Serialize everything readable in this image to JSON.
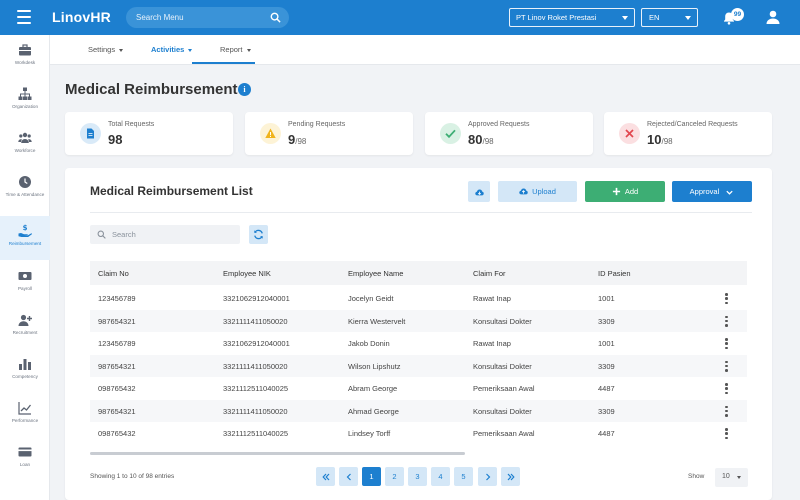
{
  "app": {
    "brand": "LinovHR",
    "search_placeholder": "Search Menu",
    "company": "PT Linov Roket Prestasi",
    "language": "EN",
    "notification_count": "99"
  },
  "sidebar": {
    "items": [
      {
        "label": "Workdesk",
        "icon": "briefcase-icon"
      },
      {
        "label": "Organization",
        "icon": "org-chart-icon"
      },
      {
        "label": "Workforce",
        "icon": "people-icon"
      },
      {
        "label": "Time & Attendance",
        "icon": "clock-icon"
      },
      {
        "label": "Reimbursement",
        "icon": "hand-dollar-icon"
      },
      {
        "label": "Payroll",
        "icon": "money-icon"
      },
      {
        "label": "Recruitment",
        "icon": "user-plus-icon"
      },
      {
        "label": "Competency",
        "icon": "bar-chart-icon"
      },
      {
        "label": "Performance",
        "icon": "trend-chart-icon"
      },
      {
        "label": "Loan",
        "icon": "card-icon"
      }
    ]
  },
  "subnav": {
    "tabs": [
      {
        "label": "Settings"
      },
      {
        "label": "Activities"
      },
      {
        "label": "Report"
      }
    ]
  },
  "page": {
    "title": "Medical Reimbursement"
  },
  "stats": [
    {
      "label": "Total Requests",
      "value": "98",
      "total": "",
      "color": "#1d7fcf"
    },
    {
      "label": "Pending Requests",
      "value": "9",
      "total": "/98",
      "color": "#f0b31c"
    },
    {
      "label": "Approved Requests",
      "value": "80",
      "total": "/98",
      "color": "#3dae74"
    },
    {
      "label": "Rejected/Canceled Requests",
      "value": "10",
      "total": "/98",
      "color": "#e2474f"
    }
  ],
  "list": {
    "title": "Medical Reimbursement List",
    "upload_label": "Upload",
    "add_label": "Add",
    "approval_label": "Approval",
    "search_placeholder": "Search",
    "columns": [
      "Claim No",
      "Employee NIK",
      "Employee Name",
      "Claim For",
      "ID Pasien"
    ],
    "rows": [
      [
        "123456789",
        "3321062912040001",
        "Jocelyn Geidt",
        "Rawat Inap",
        "1001"
      ],
      [
        "987654321",
        "3321111411050020",
        "Kierra Westervelt",
        "Konsultasi Dokter",
        "3309"
      ],
      [
        "123456789",
        "3321062912040001",
        "Jakob Donin",
        "Rawat Inap",
        "1001"
      ],
      [
        "987654321",
        "3321111411050020",
        "Wilson Lipshutz",
        "Konsultasi Dokter",
        "3309"
      ],
      [
        "098765432",
        "3321112511040025",
        "Abram George",
        "Pemeriksaan Awal",
        "4487"
      ],
      [
        "987654321",
        "3321111411050020",
        "Ahmad George",
        "Konsultasi Dokter",
        "3309"
      ],
      [
        "098765432",
        "3321112511040025",
        "Lindsey Torff",
        "Pemeriksaan Awal",
        "4487"
      ]
    ],
    "entries_text": "Showing 1 to 10 of 98 entries",
    "pages": [
      "1",
      "2",
      "3",
      "4",
      "5"
    ],
    "current_page": "1",
    "show_label": "Show",
    "page_size": "10"
  }
}
